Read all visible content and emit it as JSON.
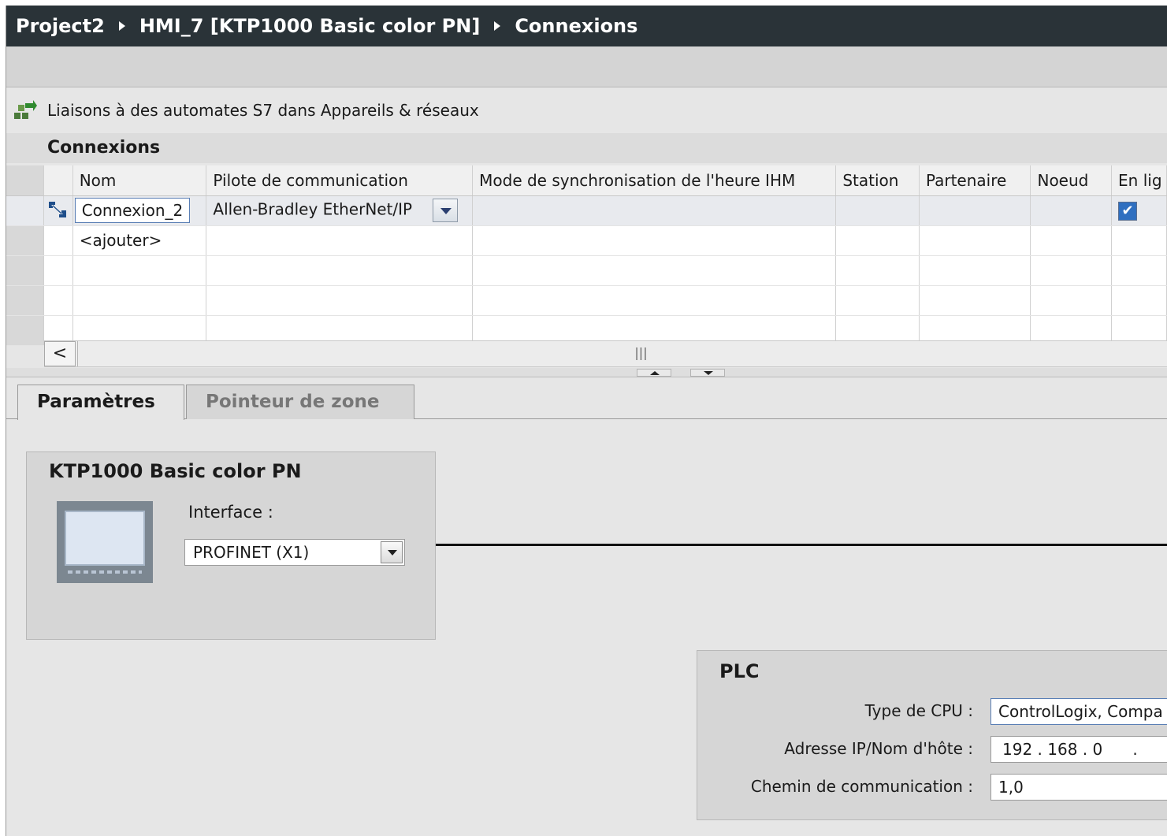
{
  "breadcrumb": {
    "project": "Project2",
    "device": "HMI_7 [KTP1000 Basic color PN]",
    "page": "Connexions"
  },
  "link_text": "Liaisons à des automates S7 dans Appareils & réseaux",
  "section_title": "Connexions",
  "grid": {
    "columns": [
      "Nom",
      "Pilote de communication",
      "Mode de synchronisation de l'heure IHM",
      "Station",
      "Partenaire",
      "Noeud",
      "En lig"
    ],
    "rows": [
      {
        "name": "Connexion_2",
        "driver": "Allen-Bradley EtherNet/IP",
        "online": true
      },
      {
        "name": "<ajouter>"
      }
    ]
  },
  "scrollbar_grip": "|||",
  "tabs": {
    "active": "Paramètres",
    "inactive": "Pointeur de zone"
  },
  "device": {
    "title": "KTP1000 Basic color PN",
    "interface_label": "Interface :",
    "interface_value": "PROFINET (X1)"
  },
  "plc": {
    "title": "PLC",
    "cpu_label": "Type de CPU :",
    "cpu_value": "ControlLogix, Compa",
    "ip_label": "Adresse IP/Nom d'hôte :",
    "ip_value": "192 . 168 . 0      .",
    "path_label": "Chemin de communication :",
    "path_value": "1,0"
  },
  "colors": {
    "titlebar": "#2a3338",
    "panel": "#e6e6e6",
    "accent": "#2f6fc0"
  }
}
